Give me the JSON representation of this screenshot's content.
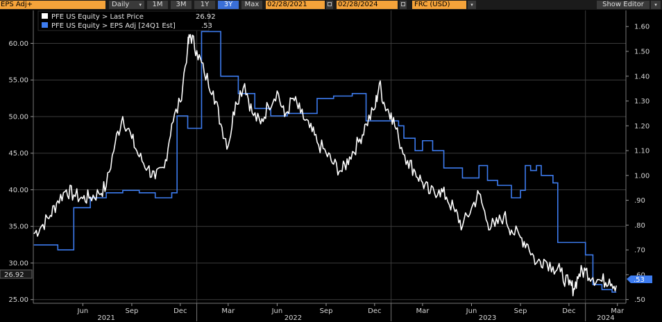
{
  "toolbar": {
    "title": "EPS Adj+",
    "period": "Daily",
    "ranges": [
      "1M",
      "3M",
      "1Y",
      "3Y",
      "Max"
    ],
    "active_range": "3Y",
    "start_date": "02/28/2021",
    "end_date": "02/28/2024",
    "currency": "FRC (USD)",
    "show_editor": "Show Editor"
  },
  "colors": {
    "price": "#ffffff",
    "eps": "#3d7cf0",
    "grid": "#3c3c3c",
    "accent": "#f5a33a"
  },
  "chart_data": {
    "type": "line",
    "legend": [
      {
        "label": "PFE US Equity > Last Price",
        "value": "26.92",
        "color": "#ffffff"
      },
      {
        "label": "PFE US Equity > EPS Adj [24Q1 Est]",
        "value": ".53",
        "color": "#3d7cf0"
      }
    ],
    "left_axis": {
      "ticks": [
        "25.00",
        "30.00",
        "35.00",
        "40.00",
        "45.00",
        "50.00",
        "55.00",
        "60.00"
      ],
      "ylim": [
        24.5,
        64.5
      ],
      "last_label": "26.92"
    },
    "right_axis": {
      "ticks": [
        ".50",
        ".60",
        ".70",
        ".80",
        ".90",
        "1.00",
        "1.10",
        "1.20",
        "1.30",
        "1.40",
        "1.50",
        "1.60"
      ],
      "ylim": [
        0.485,
        1.665
      ],
      "last_label": ".53"
    },
    "x_ticks": [
      "Jun",
      "Sep",
      "Dec",
      "Mar",
      "Jun",
      "Sep",
      "Dec",
      "Mar",
      "Jun",
      "Sep",
      "Dec",
      "Mar"
    ],
    "years": [
      "2021",
      "2022",
      "2023",
      "2024"
    ],
    "series": [
      {
        "name": "PFE US Equity > Last Price",
        "axis": "left",
        "points": [
          [
            "2021-03-01",
            34.0
          ],
          [
            "2021-03-15",
            35.0
          ],
          [
            "2021-04-01",
            36.5
          ],
          [
            "2021-04-15",
            38.5
          ],
          [
            "2021-05-01",
            40.0
          ],
          [
            "2021-05-15",
            39.3
          ],
          [
            "2021-06-01",
            38.8
          ],
          [
            "2021-06-15",
            39.0
          ],
          [
            "2021-07-01",
            39.5
          ],
          [
            "2021-07-15",
            40.5
          ],
          [
            "2021-08-01",
            46.5
          ],
          [
            "2021-08-15",
            50.0
          ],
          [
            "2021-09-01",
            47.0
          ],
          [
            "2021-09-15",
            44.5
          ],
          [
            "2021-10-01",
            43.0
          ],
          [
            "2021-10-15",
            41.5
          ],
          [
            "2021-11-01",
            43.0
          ],
          [
            "2021-11-15",
            49.0
          ],
          [
            "2021-12-01",
            52.0
          ],
          [
            "2021-12-15",
            59.5
          ],
          [
            "2021-12-20",
            61.2
          ],
          [
            "2022-01-01",
            59.0
          ],
          [
            "2022-01-15",
            56.0
          ],
          [
            "2022-02-01",
            53.5
          ],
          [
            "2022-02-15",
            49.0
          ],
          [
            "2022-03-01",
            46.0
          ],
          [
            "2022-03-15",
            52.0
          ],
          [
            "2022-04-01",
            54.5
          ],
          [
            "2022-04-15",
            50.5
          ],
          [
            "2022-05-01",
            49.0
          ],
          [
            "2022-05-15",
            51.5
          ],
          [
            "2022-06-01",
            53.5
          ],
          [
            "2022-06-15",
            50.0
          ],
          [
            "2022-07-01",
            52.5
          ],
          [
            "2022-07-15",
            50.5
          ],
          [
            "2022-08-01",
            48.5
          ],
          [
            "2022-08-15",
            46.5
          ],
          [
            "2022-09-01",
            45.0
          ],
          [
            "2022-09-15",
            43.5
          ],
          [
            "2022-10-01",
            42.5
          ],
          [
            "2022-10-15",
            44.5
          ],
          [
            "2022-11-01",
            46.5
          ],
          [
            "2022-11-15",
            49.0
          ],
          [
            "2022-12-01",
            51.0
          ],
          [
            "2022-12-10",
            54.5
          ],
          [
            "2022-12-20",
            51.5
          ],
          [
            "2023-01-01",
            50.5
          ],
          [
            "2023-01-15",
            47.0
          ],
          [
            "2023-02-01",
            44.0
          ],
          [
            "2023-02-15",
            42.5
          ],
          [
            "2023-03-01",
            41.0
          ],
          [
            "2023-03-15",
            39.5
          ],
          [
            "2023-04-01",
            40.0
          ],
          [
            "2023-04-15",
            39.0
          ],
          [
            "2023-05-01",
            37.0
          ],
          [
            "2023-05-15",
            35.0
          ],
          [
            "2023-06-01",
            37.5
          ],
          [
            "2023-06-15",
            39.5
          ],
          [
            "2023-07-01",
            35.5
          ],
          [
            "2023-07-15",
            35.0
          ],
          [
            "2023-08-01",
            36.5
          ],
          [
            "2023-08-15",
            34.5
          ],
          [
            "2023-09-01",
            33.5
          ],
          [
            "2023-09-15",
            32.5
          ],
          [
            "2023-10-01",
            30.0
          ],
          [
            "2023-10-15",
            30.5
          ],
          [
            "2023-11-01",
            29.5
          ],
          [
            "2023-11-15",
            28.8
          ],
          [
            "2023-12-01",
            27.0
          ],
          [
            "2023-12-10",
            26.5
          ],
          [
            "2023-12-20",
            28.5
          ],
          [
            "2024-01-01",
            29.0
          ],
          [
            "2024-01-15",
            28.0
          ],
          [
            "2024-02-01",
            27.5
          ],
          [
            "2024-02-15",
            27.8
          ],
          [
            "2024-02-28",
            26.92
          ]
        ]
      },
      {
        "name": "PFE US Equity > EPS Adj [24Q1 Est]",
        "axis": "right",
        "steps": [
          [
            "2021-03-01",
            0.72
          ],
          [
            "2021-04-15",
            0.7
          ],
          [
            "2021-05-15",
            0.87
          ],
          [
            "2021-06-15",
            0.91
          ],
          [
            "2021-07-15",
            0.93
          ],
          [
            "2021-08-15",
            0.94
          ],
          [
            "2021-09-15",
            0.93
          ],
          [
            "2021-10-15",
            0.91
          ],
          [
            "2021-11-15",
            0.93
          ],
          [
            "2021-11-25",
            1.24
          ],
          [
            "2021-12-15",
            1.19
          ],
          [
            "2022-01-10",
            1.58
          ],
          [
            "2022-02-15",
            1.4
          ],
          [
            "2022-03-20",
            1.33
          ],
          [
            "2022-04-20",
            1.27
          ],
          [
            "2022-05-20",
            1.24
          ],
          [
            "2022-06-20",
            1.25
          ],
          [
            "2022-08-15",
            1.31
          ],
          [
            "2022-09-15",
            1.32
          ],
          [
            "2022-10-20",
            1.33
          ],
          [
            "2022-11-15",
            1.22
          ],
          [
            "2023-01-15",
            1.2
          ],
          [
            "2023-01-25",
            1.15
          ],
          [
            "2023-02-15",
            1.1
          ],
          [
            "2023-03-01",
            1.14
          ],
          [
            "2023-03-20",
            1.1
          ],
          [
            "2023-04-10",
            1.03
          ],
          [
            "2023-04-20",
            1.03
          ],
          [
            "2023-05-15",
            0.99
          ],
          [
            "2023-06-15",
            1.04
          ],
          [
            "2023-07-01",
            0.98
          ],
          [
            "2023-07-20",
            0.96
          ],
          [
            "2023-08-15",
            0.91
          ],
          [
            "2023-09-01",
            0.94
          ],
          [
            "2023-09-10",
            1.04
          ],
          [
            "2023-09-20",
            1.02
          ],
          [
            "2023-10-01",
            1.04
          ],
          [
            "2023-10-10",
            1.0
          ],
          [
            "2023-11-01",
            0.97
          ],
          [
            "2023-11-10",
            0.73
          ],
          [
            "2023-12-01",
            0.73
          ],
          [
            "2024-01-01",
            0.68
          ],
          [
            "2024-01-15",
            0.56
          ],
          [
            "2024-02-01",
            0.54
          ],
          [
            "2024-02-20",
            0.53
          ],
          [
            "2024-02-28",
            0.53
          ]
        ]
      }
    ]
  }
}
